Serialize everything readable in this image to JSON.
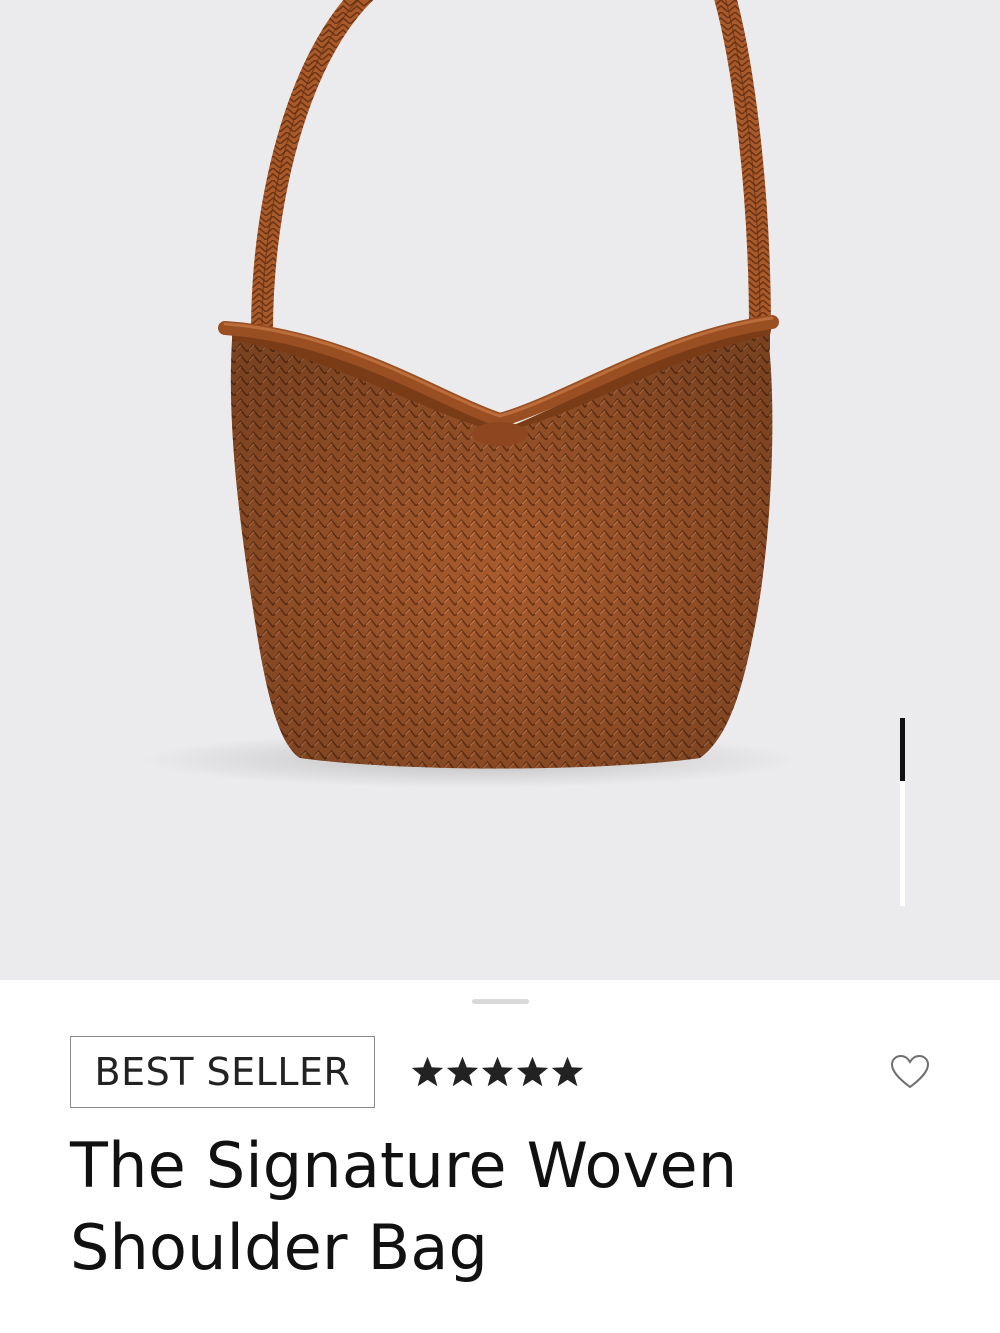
{
  "product": {
    "badge": "BEST SELLER",
    "rating": 5,
    "rating_max": 5,
    "title": "The Signature Woven Shoulder Bag",
    "image": {
      "subject": "brown woven leather shoulder bag",
      "bag_color": "#a65a2c",
      "background_color": "#ebebed"
    }
  },
  "gallery": {
    "current_image": 1,
    "image_count": 3
  },
  "icons": {
    "wishlist": "heart-outline-icon",
    "rating": "star-icon"
  },
  "colors": {
    "text": "#111111",
    "badge_border": "#8a8a8a",
    "star": "#222222",
    "indicator_active": "#111111",
    "indicator_track": "#ffffff"
  }
}
